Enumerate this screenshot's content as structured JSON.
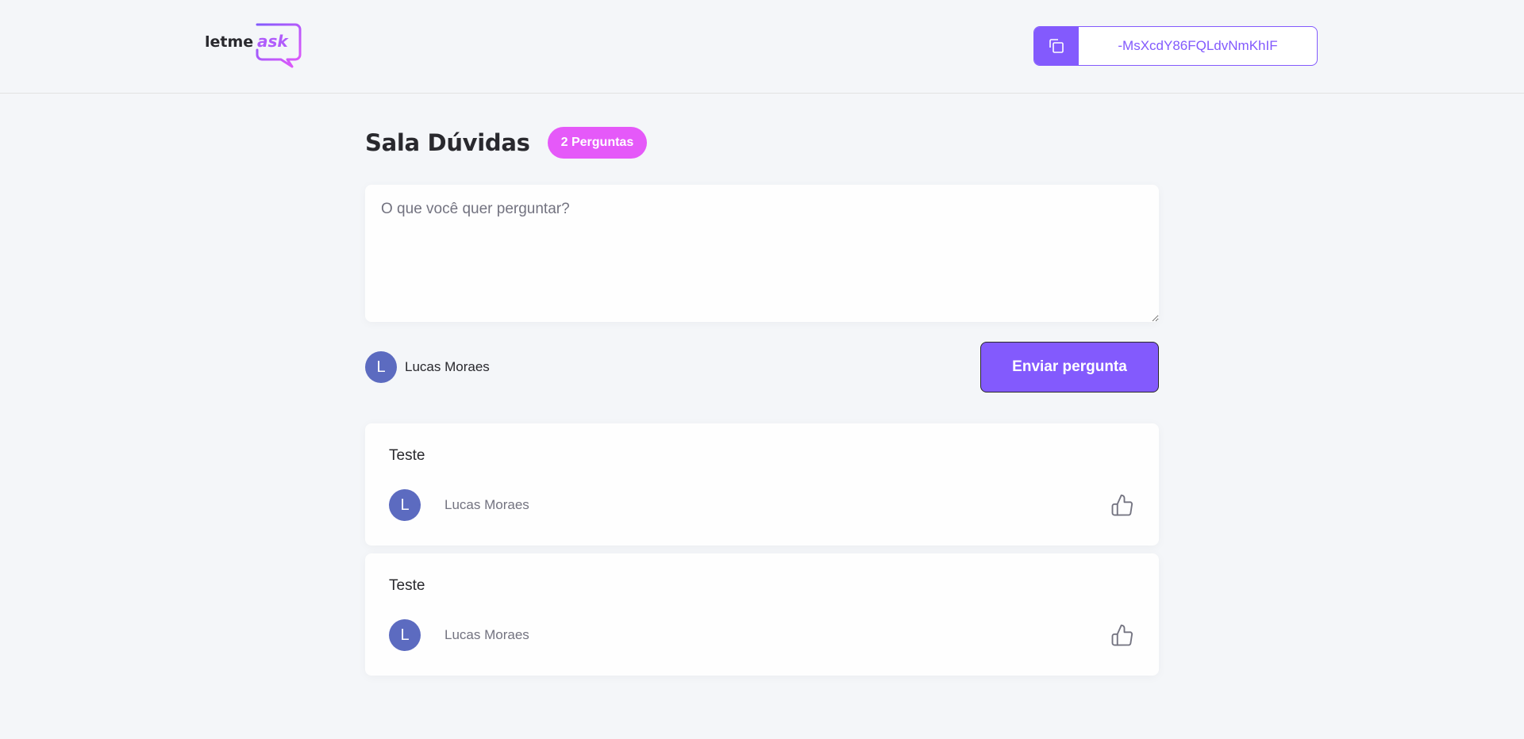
{
  "header": {
    "logo_text_1": "letme",
    "logo_text_2": "ask",
    "room_code": "-MsXcdY86FQLdvNmKhIF"
  },
  "room": {
    "title": "Sala Dúvidas",
    "question_count_label": "2 Perguntas"
  },
  "form": {
    "placeholder": "O que você quer perguntar?",
    "value": "",
    "user_initial": "L",
    "user_name": "Lucas Moraes",
    "send_label": "Enviar pergunta"
  },
  "questions": [
    {
      "content": "Teste",
      "author_initial": "L",
      "author_name": "Lucas Moraes"
    },
    {
      "content": "Teste",
      "author_initial": "L",
      "author_name": "Lucas Moraes"
    }
  ],
  "colors": {
    "accent": "#835afd",
    "badge": "#e559f9",
    "avatar": "#5c6bc0",
    "background": "#f4f6f9"
  }
}
